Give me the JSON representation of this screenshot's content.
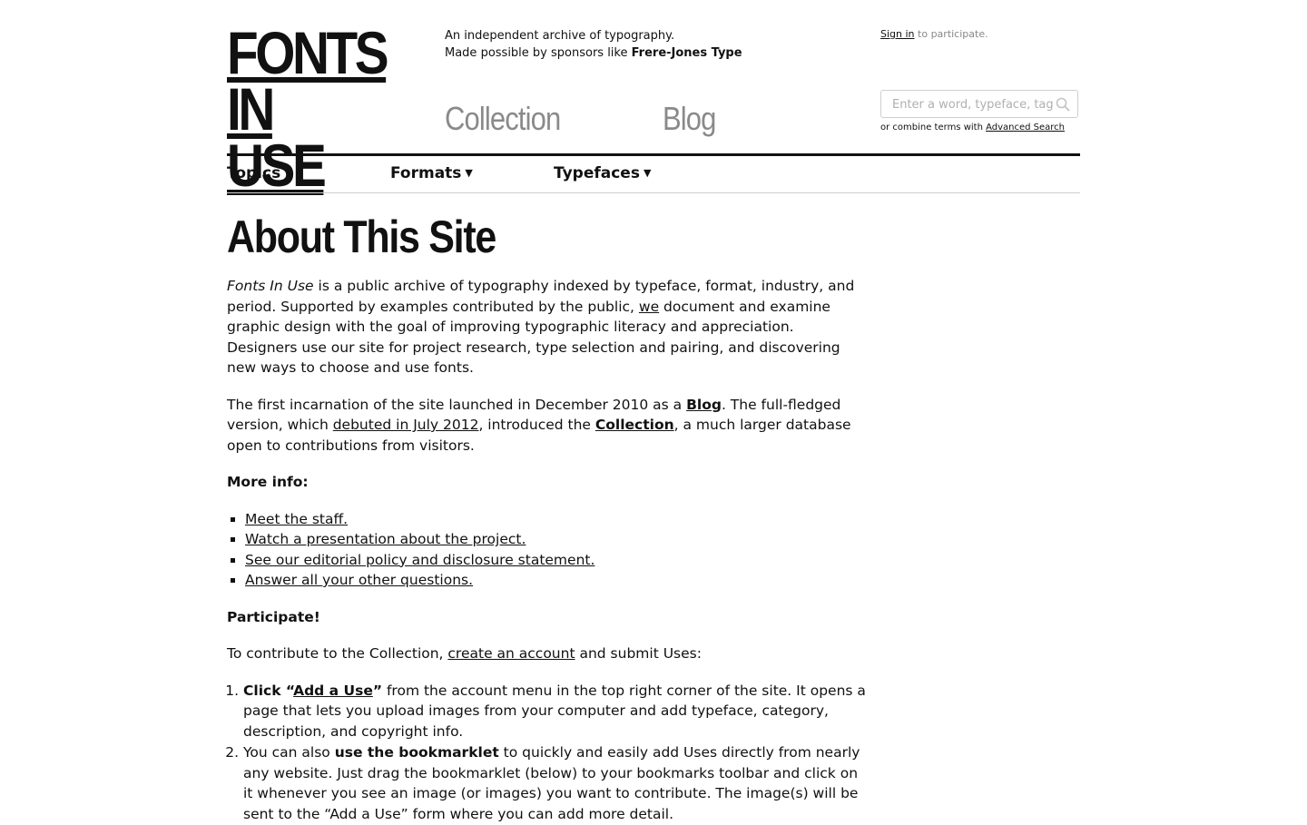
{
  "header": {
    "logo_line1": "FONTS",
    "logo_line2": "IN USE",
    "tagline_line1": "An independent archive of typography.",
    "tagline_prefix": "Made possible by sponsors like ",
    "tagline_sponsor": "Frere-Jones Type",
    "signin_link": "Sign in",
    "signin_suffix": " to participate.",
    "search_placeholder": "Enter a word, typeface, tag ...",
    "search_value": "",
    "combine_prefix": "or combine terms with ",
    "combine_link": "Advanced Search"
  },
  "nav": {
    "collection": "Collection",
    "blog": "Blog"
  },
  "subnav": {
    "topics": "Topics",
    "formats": "Formats",
    "typefaces": "Typefaces",
    "arrow": "▼"
  },
  "page": {
    "title": "About This Site",
    "p1_em": "Fonts In Use",
    "p1_a": " is a public archive of typography indexed by typeface, format, industry, and period. Supported by examples contributed by the public, ",
    "p1_we": "we",
    "p1_b": " document and examine graphic design with the goal of improving typographic literacy and appreciation. Designers use our site for project research, type selection and pairing, and discovering new ways to choose and use fonts.",
    "p2_a": "The first incarnation of the site launched in December 2010 as a ",
    "p2_blog": "Blog",
    "p2_b": ". The full-fledged version, which ",
    "p2_debut": "debuted in July 2012",
    "p2_c": ", introduced the ",
    "p2_collection": "Collection",
    "p2_d": ", a much larger database open to contributions from visitors.",
    "more_info_heading": "More info:",
    "more_info": [
      "Meet the staff.",
      "Watch a presentation about the project.",
      "See our editorial policy and disclosure statement.",
      "Answer all your other questions."
    ],
    "participate_heading": "Participate!",
    "contribute_a": "To contribute to the Collection, ",
    "contribute_link": "create an account",
    "contribute_b": " and submit Uses:",
    "step1_bold": "Click “",
    "step1_link": "Add a Use",
    "step1_bold_end": "”",
    "step1_rest": " from the account menu in the top right corner of the site. It opens a page that lets you upload images from your computer and add typeface, category, description, and copyright info.",
    "step2_a": "You can also ",
    "step2_bold": "use the bookmarklet",
    "step2_b": " to quickly and easily add Uses directly from nearly any website. Just drag the bookmarklet (below) to your bookmarks toolbar and click on it whenever you see an image (or images) you want to contribute. The image(s) will be sent to the “Add a Use” form where you can add more detail."
  }
}
